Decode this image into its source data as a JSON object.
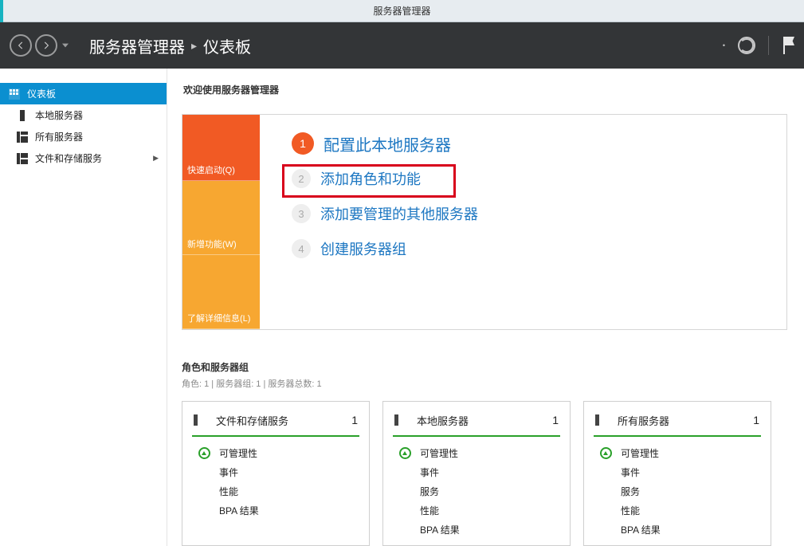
{
  "window": {
    "title": "服务器管理器"
  },
  "header": {
    "crumb_main": "服务器管理器",
    "crumb_sep": "▸",
    "crumb_sub": "仪表板"
  },
  "sidebar": {
    "items": [
      {
        "label": "仪表板",
        "icon": "dashboard-icon",
        "active": true
      },
      {
        "label": "本地服务器",
        "icon": "local-server-icon"
      },
      {
        "label": "所有服务器",
        "icon": "all-servers-icon"
      },
      {
        "label": "文件和存储服务",
        "icon": "storage-icon",
        "expandable": true
      }
    ]
  },
  "welcome": {
    "title": "欢迎使用服务器管理器",
    "left": {
      "seg1": "快速启动(Q)",
      "seg2": "新增功能(W)",
      "seg3": "了解详细信息(L)"
    },
    "steps": {
      "s1": {
        "num": "1",
        "label": "配置此本地服务器"
      },
      "s2": {
        "num": "2",
        "label": "添加角色和功能"
      },
      "s3": {
        "num": "3",
        "label": "添加要管理的其他服务器"
      },
      "s4": {
        "num": "4",
        "label": "创建服务器组"
      }
    }
  },
  "groups": {
    "title": "角色和服务器组",
    "sub": "角色: 1 | 服务器组: 1 | 服务器总数: 1",
    "tiles": [
      {
        "title": "文件和存储服务",
        "count": "1",
        "rows": [
          "可管理性",
          "事件",
          "性能",
          "BPA 结果"
        ],
        "first_has_icon": true
      },
      {
        "title": "本地服务器",
        "count": "1",
        "rows": [
          "可管理性",
          "事件",
          "服务",
          "性能",
          "BPA 结果"
        ],
        "first_has_icon": true
      },
      {
        "title": "所有服务器",
        "count": "1",
        "rows": [
          "可管理性",
          "事件",
          "服务",
          "性能",
          "BPA 结果"
        ],
        "first_has_icon": true
      }
    ]
  }
}
